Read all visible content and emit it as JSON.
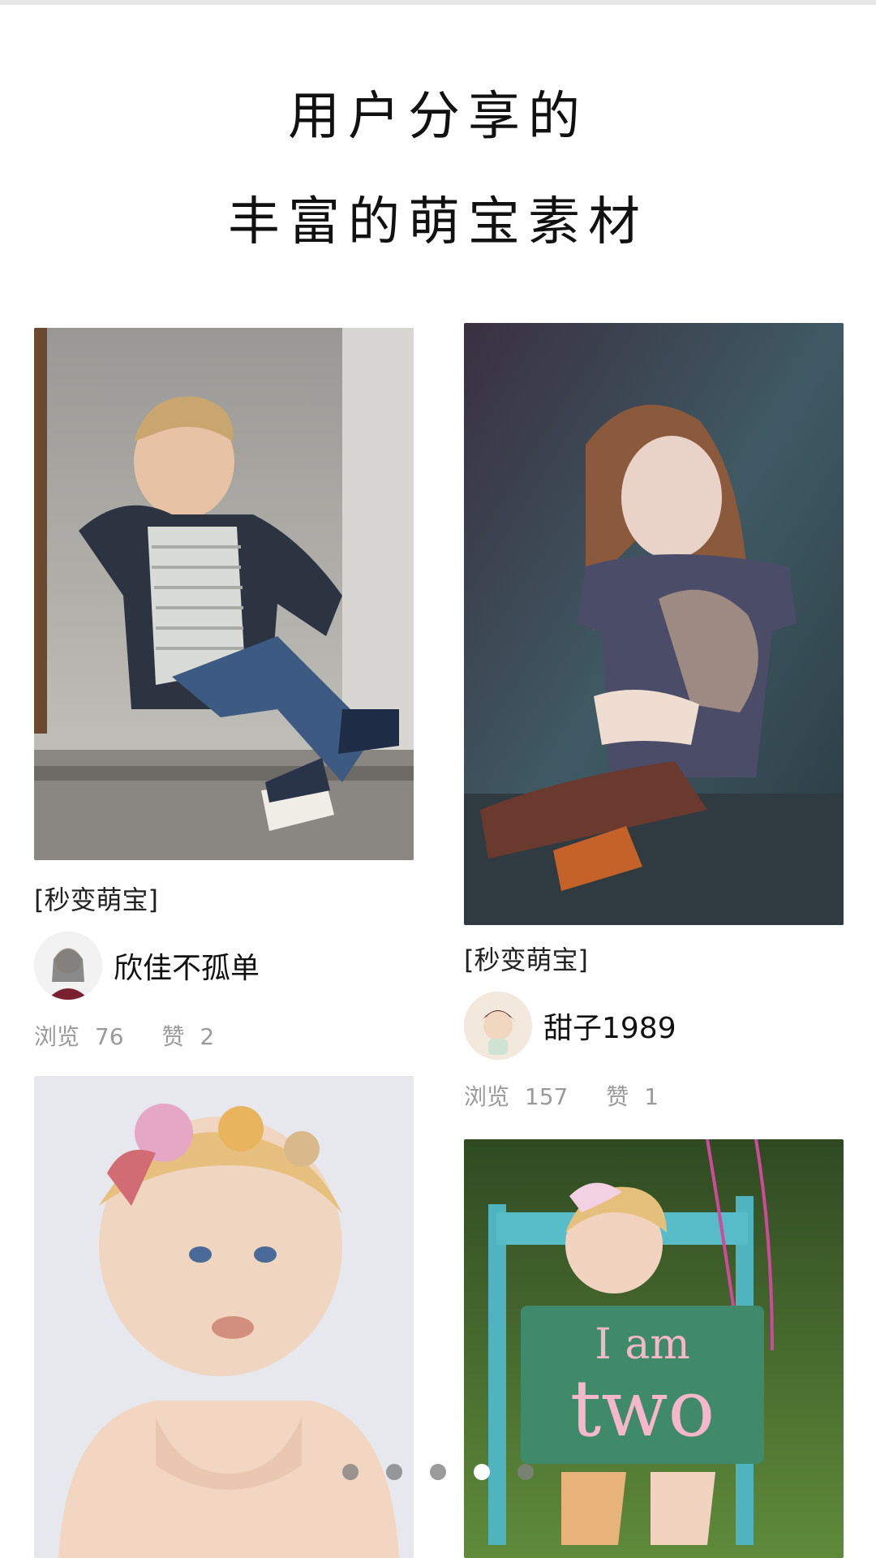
{
  "header": {
    "line1": "用户分享的",
    "line2": "丰富的萌宝素材"
  },
  "cards": [
    {
      "tag": "[秒变萌宝]",
      "username": "欣佳不孤单",
      "views_label": "浏览",
      "views": "76",
      "likes_label": "赞",
      "likes": "2"
    },
    {
      "tag": "[秒变萌宝]",
      "username": "甜子1989",
      "views_label": "浏览",
      "views": "157",
      "likes_label": "赞",
      "likes": "1"
    },
    {
      "photo_text": {
        "line1": "I am",
        "line2": "two"
      }
    }
  ],
  "pagination": {
    "total": 5,
    "active_index": 3
  }
}
